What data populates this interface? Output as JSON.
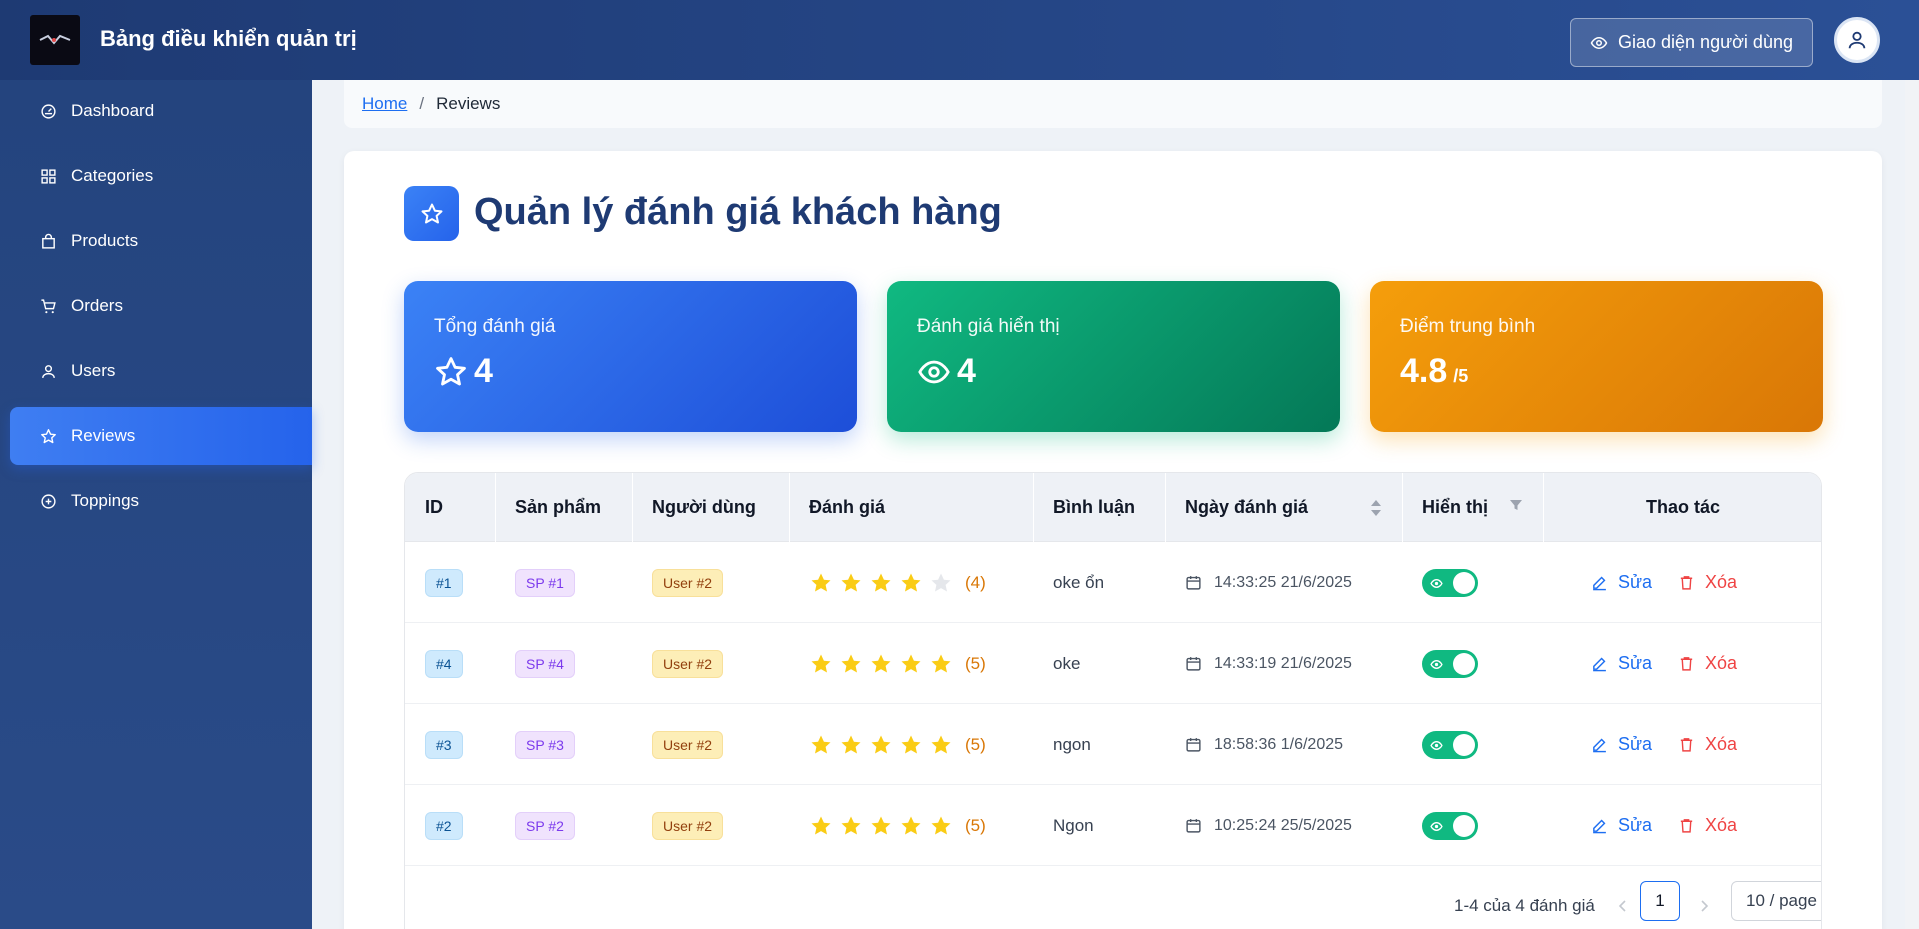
{
  "header": {
    "app_title": "Bảng điều khiển quản trị",
    "user_view_button": "Giao diện người dùng"
  },
  "sidebar": {
    "items": [
      {
        "label": "Dashboard",
        "icon": "dashboard-icon"
      },
      {
        "label": "Categories",
        "icon": "grid-icon"
      },
      {
        "label": "Products",
        "icon": "shopping-bag-icon"
      },
      {
        "label": "Orders",
        "icon": "cart-icon"
      },
      {
        "label": "Users",
        "icon": "user-icon"
      },
      {
        "label": "Reviews",
        "icon": "star-icon",
        "active": true
      },
      {
        "label": "Toppings",
        "icon": "plus-circle-icon"
      }
    ]
  },
  "breadcrumb": {
    "home": "Home",
    "separator": "/",
    "current": "Reviews"
  },
  "page": {
    "title": "Quản lý đánh giá khách hàng"
  },
  "stats": {
    "total": {
      "label": "Tổng đánh giá",
      "value": "4"
    },
    "visible": {
      "label": "Đánh giá hiển thị",
      "value": "4"
    },
    "average": {
      "label": "Điểm trung bình",
      "value": "4.8",
      "suffix": "/5"
    }
  },
  "table": {
    "columns": [
      "ID",
      "Sản phẩm",
      "Người dùng",
      "Đánh giá",
      "Bình luận",
      "Ngày đánh giá",
      "Hiển thị",
      "Thao tác"
    ],
    "edit_label": "Sửa",
    "delete_label": "Xóa",
    "rows": [
      {
        "id": "#1",
        "product": "SP #1",
        "user": "User #2",
        "rating": 4,
        "rating_text": "(4)",
        "comment": "oke ổn",
        "date": "14:33:25 21/6/2025",
        "visible": true
      },
      {
        "id": "#4",
        "product": "SP #4",
        "user": "User #2",
        "rating": 5,
        "rating_text": "(5)",
        "comment": "oke",
        "date": "14:33:19 21/6/2025",
        "visible": true
      },
      {
        "id": "#3",
        "product": "SP #3",
        "user": "User #2",
        "rating": 5,
        "rating_text": "(5)",
        "comment": "ngon",
        "date": "18:58:36 1/6/2025",
        "visible": true
      },
      {
        "id": "#2",
        "product": "SP #2",
        "user": "User #2",
        "rating": 5,
        "rating_text": "(5)",
        "comment": "Ngon",
        "date": "10:25:24 25/5/2025",
        "visible": true
      }
    ]
  },
  "pagination": {
    "total_text": "1-4 của 4 đánh giá",
    "current_page": "1",
    "page_size": "10 / page"
  },
  "colors": {
    "header": "#1e3a73",
    "accent": "#2563eb",
    "star": "#facc15",
    "toggle_on": "#10b981",
    "delete": "#ef4444"
  }
}
